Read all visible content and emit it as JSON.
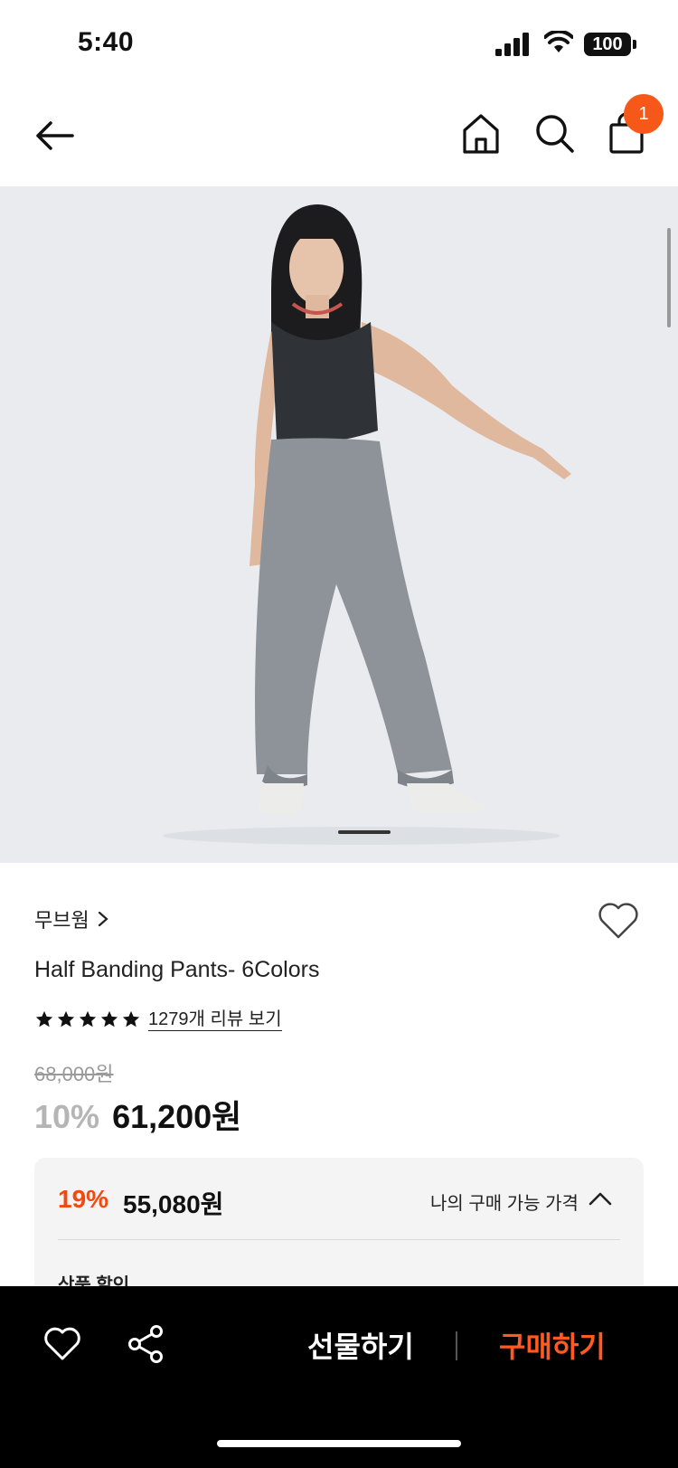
{
  "status_bar": {
    "time": "5:40",
    "battery": "100",
    "icons": [
      "signal-icon",
      "wifi-icon",
      "battery-icon"
    ]
  },
  "header": {
    "icons": [
      "back-arrow-icon",
      "home-icon",
      "search-icon",
      "shopping-bag-icon"
    ],
    "cart_badge": "1",
    "accent_color": "#f6581a"
  },
  "product": {
    "brand": "무브웜",
    "title": "Half Banding Pants- 6Colors",
    "rating_stars": 5,
    "review_link": "1279개 리뷰 보기",
    "original_price": "68,000원",
    "discount_rate": "10%",
    "sale_price": "61,200원"
  },
  "benefit": {
    "rate": "19%",
    "price": "55,080원",
    "my_price_label": "나의 구매 가능 가격",
    "section_label": "상품 할인",
    "rate_color": "#f04a10"
  },
  "bottom_bar": {
    "gift_label": "선물하기",
    "buy_label": "구매하기",
    "buy_color": "#ff5a1f",
    "icons": [
      "heart-icon",
      "share-icon"
    ]
  }
}
